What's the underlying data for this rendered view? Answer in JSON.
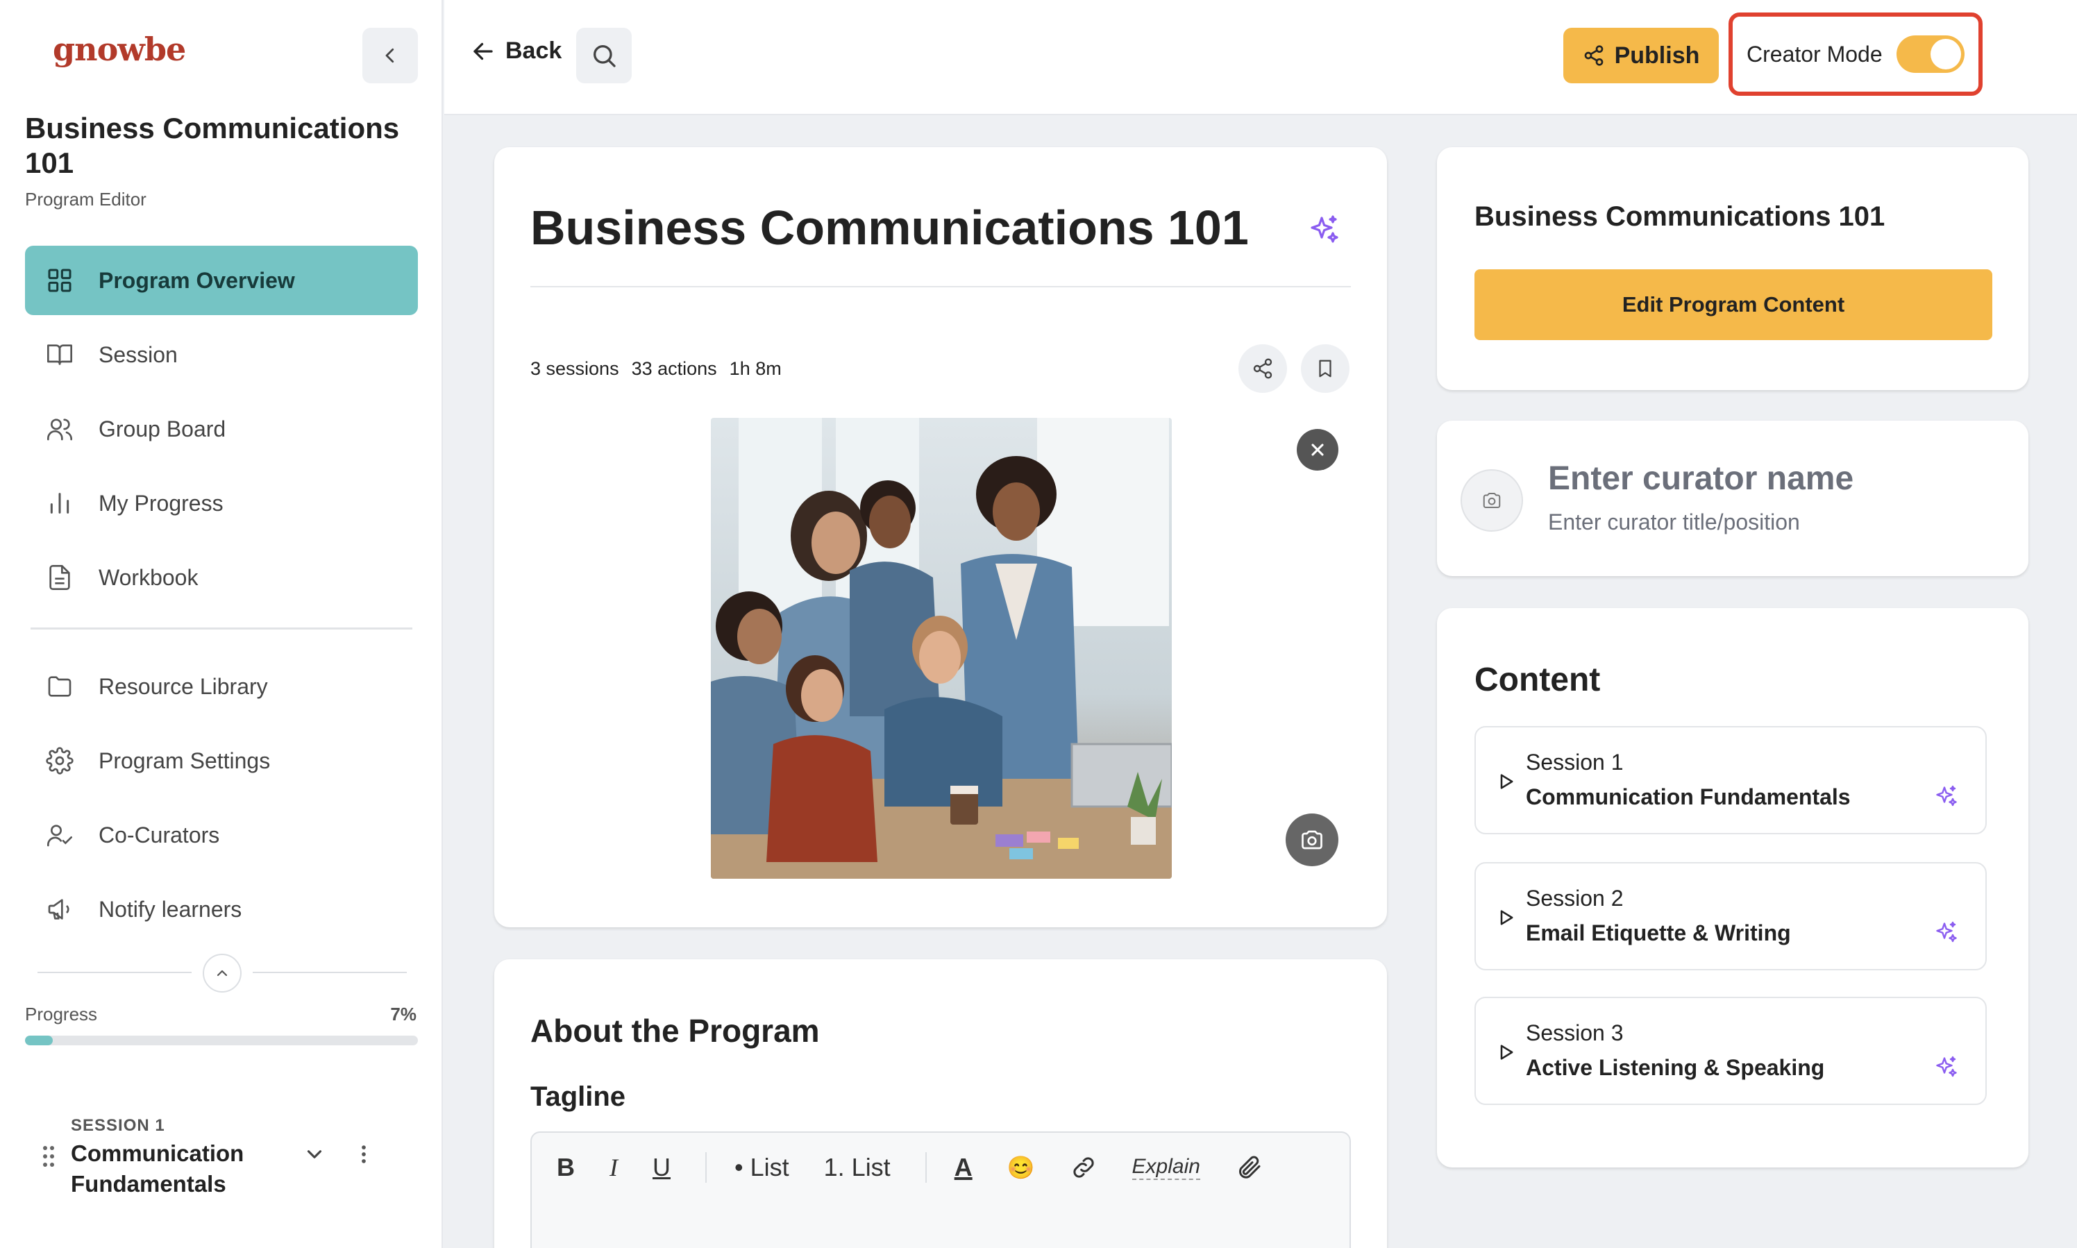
{
  "brand": {
    "logo_text": "gnowbe",
    "logo_color": "#b23a2a",
    "accent": "#75c4c4",
    "primary": "#f5b94a"
  },
  "sidebar": {
    "program_title": "Business Communications 101",
    "program_subtitle": "Program Editor",
    "nav_items": [
      {
        "label": "Program Overview",
        "icon": "grid-icon",
        "active": true
      },
      {
        "label": "Session",
        "icon": "book-icon"
      },
      {
        "label": "Group Board",
        "icon": "users-icon"
      },
      {
        "label": "My Progress",
        "icon": "bar-chart-icon"
      },
      {
        "label": "Workbook",
        "icon": "document-icon"
      }
    ],
    "nav_items_secondary": [
      {
        "label": "Resource Library",
        "icon": "folder-icon"
      },
      {
        "label": "Program Settings",
        "icon": "gear-icon"
      },
      {
        "label": "Co-Curators",
        "icon": "user-check-icon"
      },
      {
        "label": "Notify learners",
        "icon": "megaphone-icon"
      }
    ],
    "progress": {
      "label": "Progress",
      "value_text": "7%",
      "fraction": 0.07
    },
    "current_session": {
      "label": "SESSION 1",
      "title": "Communication Fundamentals"
    }
  },
  "topbar": {
    "back_label": "Back",
    "publish_label": "Publish",
    "creator_mode_label": "Creator Mode",
    "creator_mode_on": true
  },
  "main": {
    "title": "Business Communications 101",
    "stats": {
      "sessions": "3 sessions",
      "actions": "33 actions",
      "duration": "1h 8m"
    }
  },
  "about": {
    "title": "About the Program",
    "tagline_title": "Tagline",
    "toolbar": {
      "bold": "B",
      "italic": "I",
      "underline": "U",
      "bullet_list": "• List",
      "numbered_list": "1. List",
      "text_color": "A",
      "emoji": "😊",
      "explain": "Explain"
    }
  },
  "right_panel": {
    "program_title": "Business Communications 101",
    "edit_button": "Edit Program Content",
    "curator_name_placeholder": "Enter curator name",
    "curator_title_placeholder": "Enter curator title/position",
    "content_title": "Content",
    "sessions": [
      {
        "number": "Session 1",
        "name": "Communication Fundamentals"
      },
      {
        "number": "Session 2",
        "name": "Email Etiquette & Writing"
      },
      {
        "number": "Session 3",
        "name": "Active Listening & Speaking"
      }
    ]
  }
}
